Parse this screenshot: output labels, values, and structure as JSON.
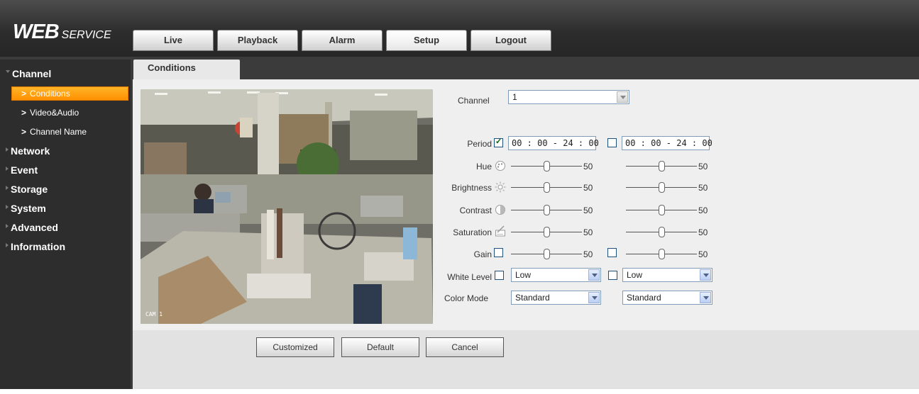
{
  "header": {
    "logo_bold": "WEB",
    "logo_light": "SERVICE",
    "tabs": [
      {
        "label": "Live"
      },
      {
        "label": "Playback"
      },
      {
        "label": "Alarm"
      },
      {
        "label": "Setup"
      },
      {
        "label": "Logout"
      }
    ],
    "active_tab": "Setup"
  },
  "sidebar": {
    "channel": "Channel",
    "channel_items": [
      "Conditions",
      "Video&Audio",
      "Channel Name"
    ],
    "sections": [
      "Network",
      "Event",
      "Storage",
      "System",
      "Advanced",
      "Information"
    ],
    "active_item": "Conditions"
  },
  "page": {
    "tab": "Conditions"
  },
  "video": {
    "overlay_label": "CAM 1"
  },
  "form": {
    "channel_label": "Channel",
    "channel_value": "1",
    "period_label": "Period",
    "period1": "00 : 00  -  24 : 00",
    "period2": "00 : 00  -  24 : 00",
    "period1_checked": true,
    "period2_checked": false,
    "hue_label": "Hue",
    "brightness_label": "Brightness",
    "contrast_label": "Contrast",
    "saturation_label": "Saturation",
    "gain_label": "Gain",
    "white_level_label": "White Level",
    "color_mode_label": "Color Mode",
    "hue": [
      50,
      50
    ],
    "brightness": [
      50,
      50
    ],
    "contrast": [
      50,
      50
    ],
    "saturation": [
      50,
      50
    ],
    "gain": [
      50,
      50
    ],
    "slider_max": 100,
    "hue_text": [
      "50",
      "50"
    ],
    "brightness_text": [
      "50",
      "50"
    ],
    "contrast_text": [
      "50",
      "50"
    ],
    "saturation_text": [
      "50",
      "50"
    ],
    "gain_text": [
      "50",
      "50"
    ],
    "white_level": [
      "Low",
      "Low"
    ],
    "color_mode": [
      "Standard",
      "Standard"
    ]
  },
  "buttons": {
    "customized": "Customized",
    "default": "Default",
    "cancel": "Cancel"
  },
  "icons": [
    "hue-icon",
    "brightness-icon",
    "contrast-icon",
    "saturation-icon"
  ]
}
